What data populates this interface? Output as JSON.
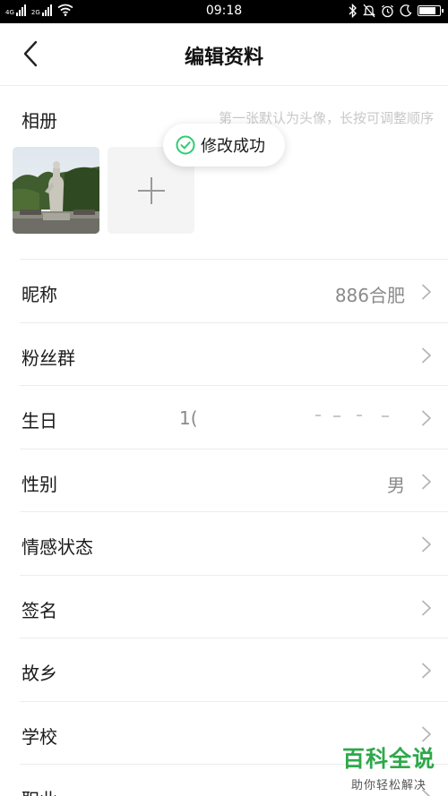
{
  "status_bar": {
    "time": "09:18",
    "sim1_tag": "4G",
    "sim2_tag": "2G",
    "battery_level": 0.85
  },
  "nav": {
    "title": "编辑资料"
  },
  "album": {
    "label": "相册",
    "hint": "第一张默认为头像，长按可调整顺序"
  },
  "toast": {
    "text": "修改成功"
  },
  "rows": [
    {
      "label": "昵称",
      "value": "886合肥"
    },
    {
      "label": "粉丝群",
      "value": ""
    },
    {
      "label": "生日",
      "value": "1("
    },
    {
      "label": "性别",
      "value": "男"
    },
    {
      "label": "情感状态",
      "value": ""
    },
    {
      "label": "签名",
      "value": ""
    },
    {
      "label": "故乡",
      "value": ""
    },
    {
      "label": "学校",
      "value": ""
    },
    {
      "label": "职业",
      "value": ""
    }
  ],
  "watermark": {
    "main": "百科全说",
    "sub": "助你轻松解决"
  },
  "colors": {
    "accent_green": "#2ecc71",
    "watermark_green": "#2ea84a"
  }
}
